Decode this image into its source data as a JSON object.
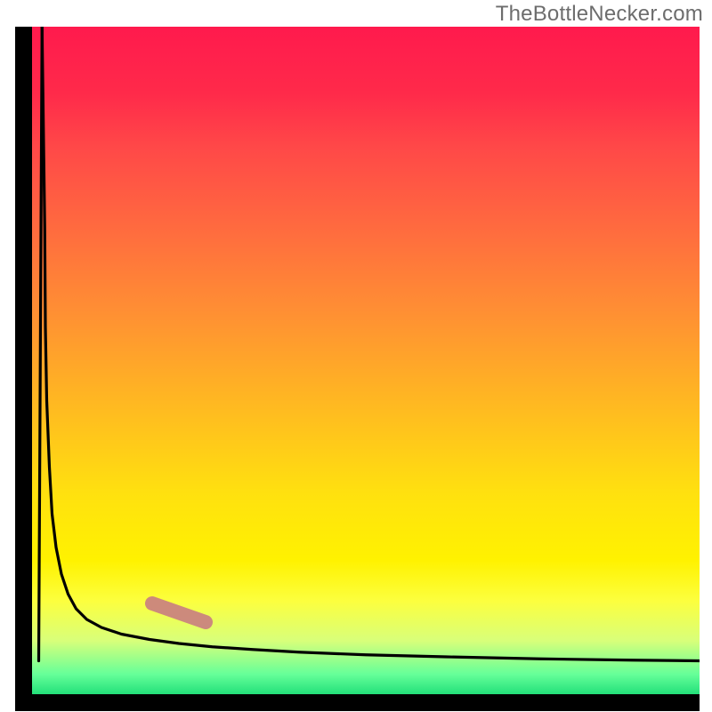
{
  "attribution": "TheBottleNecker.com",
  "chart_data": {
    "type": "line",
    "title": "",
    "xlabel": "",
    "ylabel": "",
    "xlim": [
      0,
      100
    ],
    "ylim": [
      0,
      100
    ],
    "background_gradient": {
      "top": "#ff1a4d",
      "middle_upper": "#ff8d34",
      "middle": "#fff200",
      "bottom": "#23e07a"
    },
    "series": [
      {
        "name": "bottleneck-curve",
        "color": "#000000",
        "x": [
          1.5,
          1.9,
          2.0,
          2.2,
          2.6,
          3.0,
          3.6,
          4.4,
          5.4,
          6.6,
          8.2,
          10.4,
          13.4,
          17.6,
          22.0,
          27.0,
          33.0,
          40.0,
          50.0,
          62.0,
          76.0,
          90.0,
          100.0
        ],
        "y": [
          100,
          70,
          55,
          44,
          34,
          27,
          22,
          18,
          15,
          12.8,
          11.2,
          10.0,
          9.0,
          8.2,
          7.6,
          7.1,
          6.7,
          6.3,
          5.9,
          5.6,
          5.3,
          5.1,
          5.0
        ]
      },
      {
        "name": "curve-start-dip",
        "color": "#000000",
        "x": [
          1.0,
          1.5
        ],
        "y": [
          5.0,
          100
        ]
      }
    ],
    "marker": {
      "name": "highlight-segment",
      "color": "#c98080",
      "x_range": [
        18,
        26
      ],
      "y_range": [
        10.8,
        13.6
      ],
      "thickness_px": 16
    }
  }
}
